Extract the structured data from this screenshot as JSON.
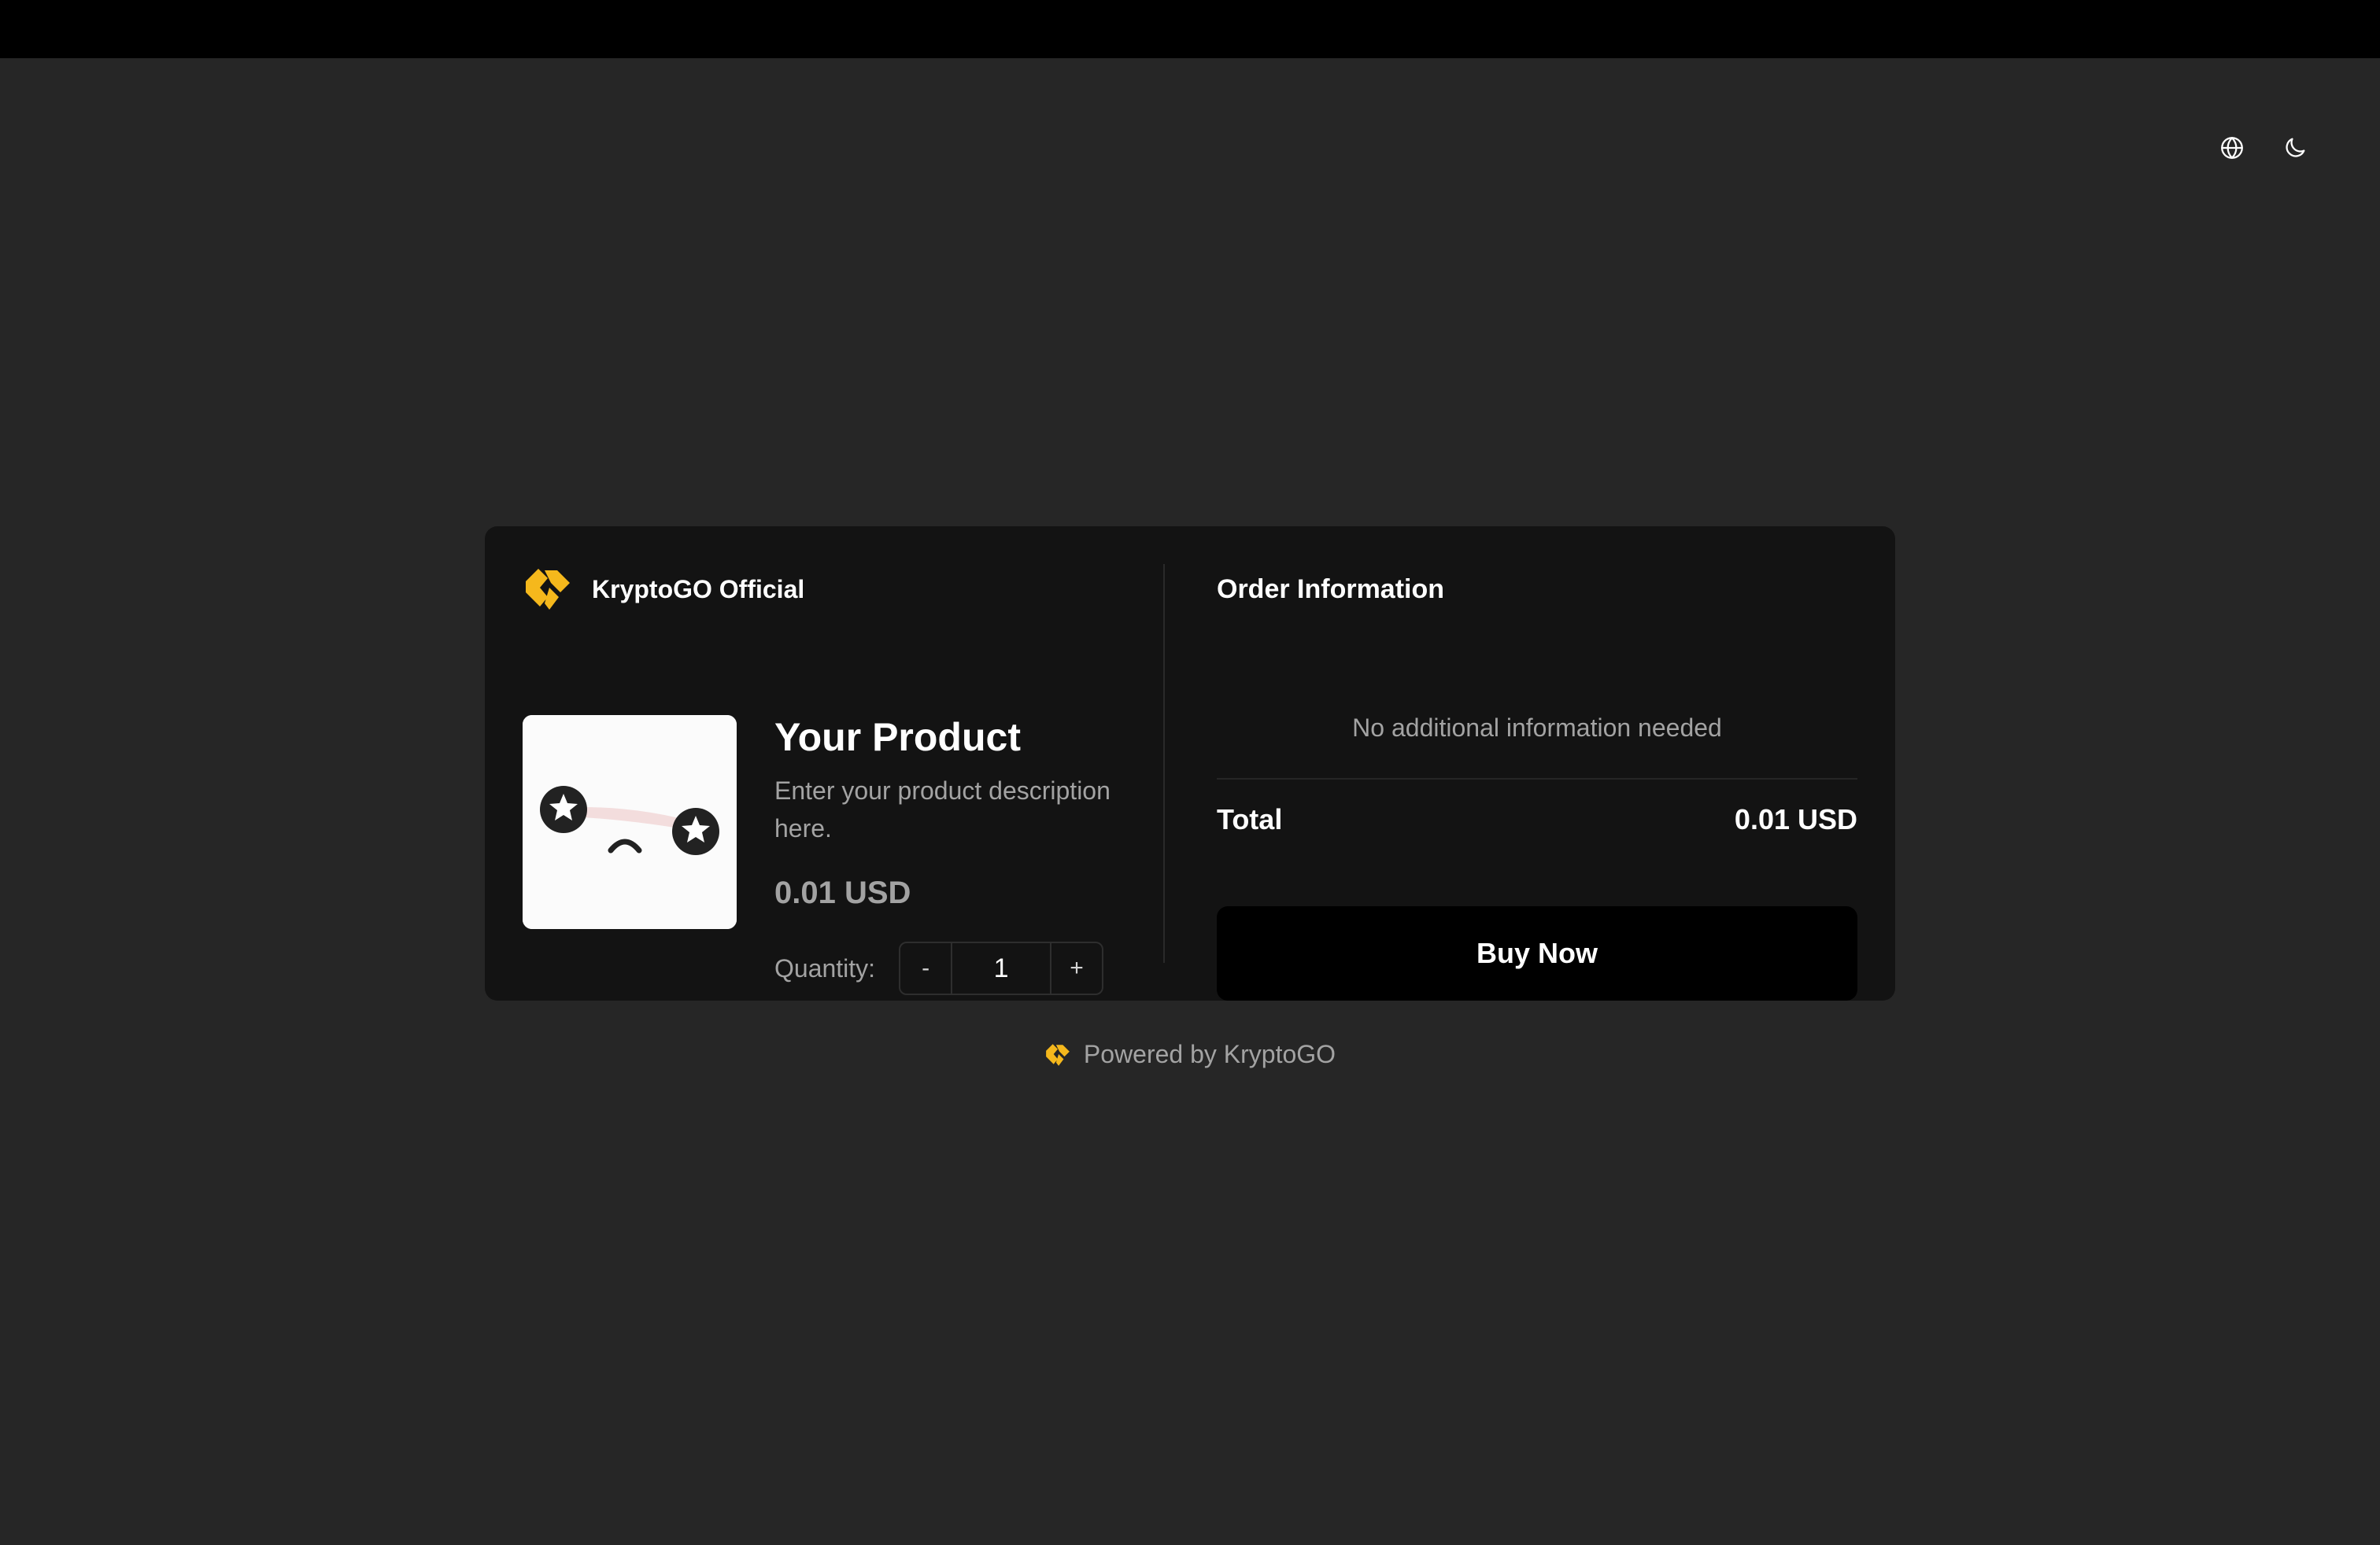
{
  "colors": {
    "accent": "#F5B81C",
    "background": "#262626",
    "card": "#131313",
    "button": "#000000"
  },
  "header": {
    "language_icon": "globe-icon",
    "theme_icon": "moon-icon"
  },
  "merchant": {
    "name": "KryptoGO Official",
    "logo": "kryptogo-logo"
  },
  "product": {
    "title": "Your Product",
    "description": "Enter your product description here.",
    "price": "0.01 USD",
    "quantity_label": "Quantity:",
    "quantity": "1",
    "decrement_label": "-",
    "increment_label": "+"
  },
  "order": {
    "title": "Order Information",
    "no_info": "No additional information needed",
    "total_label": "Total",
    "total_value": "0.01 USD",
    "buy_label": "Buy Now"
  },
  "footer": {
    "text": "Powered by KryptoGO"
  }
}
